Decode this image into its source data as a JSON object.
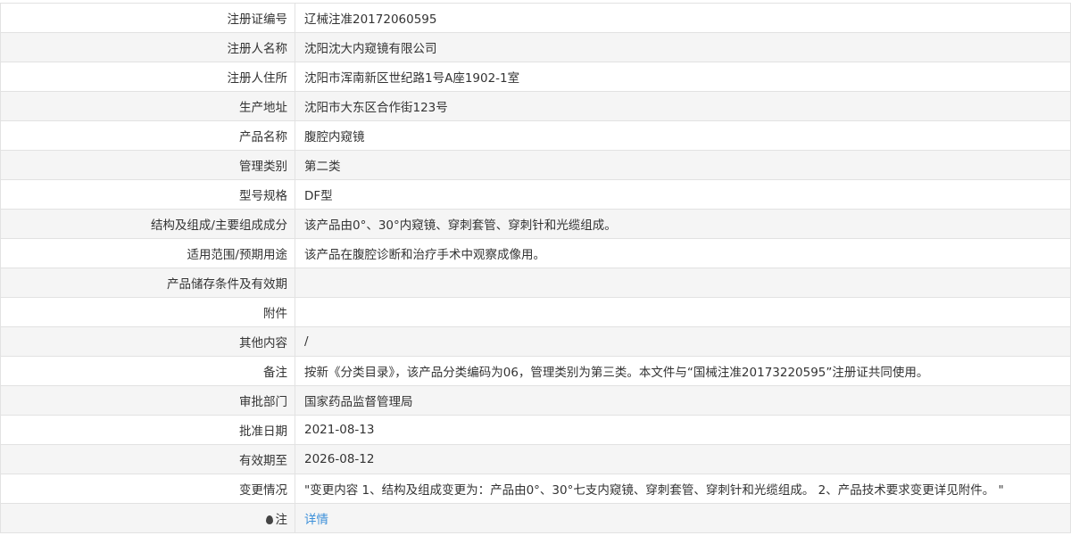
{
  "rows": [
    {
      "label": "注册证编号",
      "value": "辽械注准20172060595"
    },
    {
      "label": "注册人名称",
      "value": "沈阳沈大内窥镜有限公司"
    },
    {
      "label": "注册人住所",
      "value": "沈阳市浑南新区世纪路1号A座1902-1室"
    },
    {
      "label": "生产地址",
      "value": "沈阳市大东区合作街123号"
    },
    {
      "label": "产品名称",
      "value": "腹腔内窥镜"
    },
    {
      "label": "管理类别",
      "value": "第二类"
    },
    {
      "label": "型号规格",
      "value": "DF型"
    },
    {
      "label": "结构及组成/主要组成成分",
      "value": "该产品由0°、30°内窥镜、穿刺套管、穿刺针和光缆组成。"
    },
    {
      "label": "适用范围/预期用途",
      "value": "该产品在腹腔诊断和治疗手术中观察成像用。"
    },
    {
      "label": "产品储存条件及有效期",
      "value": ""
    },
    {
      "label": "附件",
      "value": ""
    },
    {
      "label": "其他内容",
      "value": "/"
    },
    {
      "label": "备注",
      "value": "按新《分类目录》，该产品分类编码为06，管理类别为第三类。本文件与“国械注准20173220595”注册证共同使用。"
    },
    {
      "label": "审批部门",
      "value": "国家药品监督管理局"
    },
    {
      "label": "批准日期",
      "value": "2021-08-13"
    },
    {
      "label": "有效期至",
      "value": "2026-08-12"
    },
    {
      "label": "变更情况",
      "value": "\"变更内容 1、结构及组成变更为：产品由0°、30°七支内窥镜、穿刺套管、穿刺针和光缆组成。 2、产品技术要求变更详见附件。 \""
    }
  ],
  "note": {
    "label": "注",
    "icon": "map-pin-icon",
    "link": "详情"
  }
}
